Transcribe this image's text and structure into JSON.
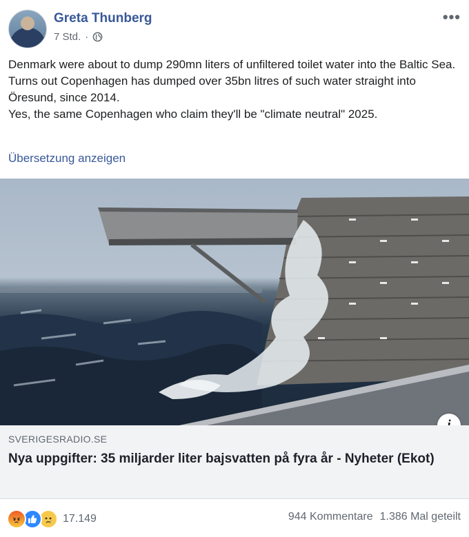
{
  "post": {
    "author": "Greta Thunberg",
    "time": "7 Std.",
    "separator": "·",
    "privacy_icon": "globe-icon",
    "more_icon": "more-options-icon",
    "more_label": "•••",
    "text": [
      "Denmark were about to dump 290mn liters of unfiltered toilet water into the Baltic Sea.",
      "Turns out Copenhagen has dumped over 35bn litres of such water straight into Öresund, since 2014.",
      "Yes, the same Copenhagen who claim they'll be \"climate neutral\" 2025."
    ],
    "translate_label": "Übersetzung anzeigen"
  },
  "link": {
    "domain": "SVERIGESRADIO.SE",
    "headline": "Nya uppgifter: 35 miljarder liter bajsvatten på fyra år - Nyheter (Ekot)",
    "info_label": "i",
    "image_icon": "harbour-photo"
  },
  "footer": {
    "reaction_icons": [
      "angry-icon",
      "like-icon",
      "sad-icon"
    ],
    "reaction_count": "17.149",
    "comments": "944 Kommentare",
    "shares": "1.386 Mal geteilt"
  },
  "colors": {
    "link_blue": "#385898",
    "meta_gray": "#606770",
    "text": "#1c1e21",
    "preview_bg": "#f2f3f5"
  }
}
